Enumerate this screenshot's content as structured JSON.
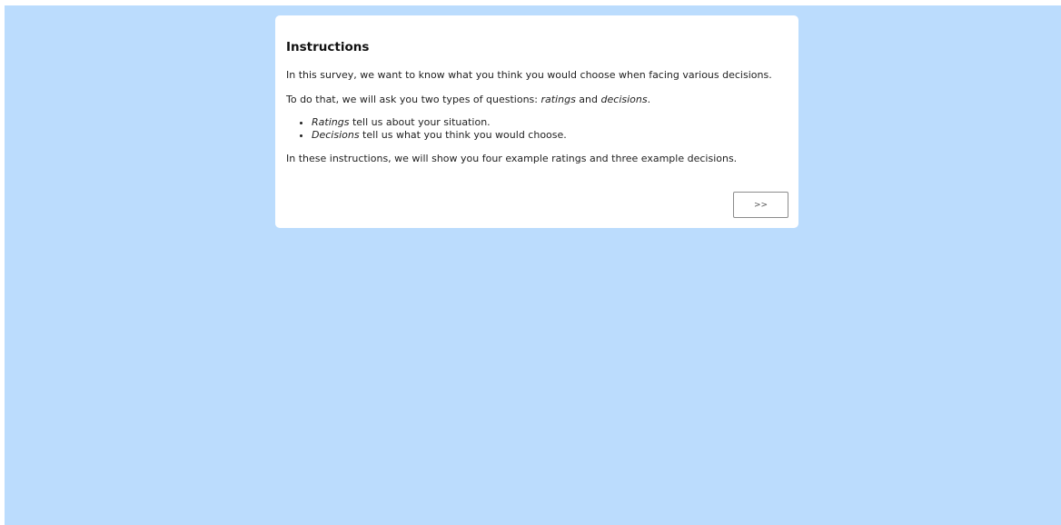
{
  "instructions": {
    "title": "Instructions",
    "paragraph_1": "In this survey, we want to know what you think you would choose when facing various decisions.",
    "paragraph_2": {
      "prefix": "To do that, we will ask you two types of questions: ",
      "term_1": "ratings",
      "middle": " and ",
      "term_2": "decisions",
      "suffix": "."
    },
    "bullets": [
      {
        "term": "Ratings",
        "text": " tell us about your situation."
      },
      {
        "term": "Decisions",
        "text": " tell us what you think you would choose."
      }
    ],
    "paragraph_3": "In these instructions, we will show you four example ratings and three example decisions.",
    "next_label": ">>"
  },
  "colors": {
    "background": "#bbdcfd",
    "card": "#ffffff"
  }
}
